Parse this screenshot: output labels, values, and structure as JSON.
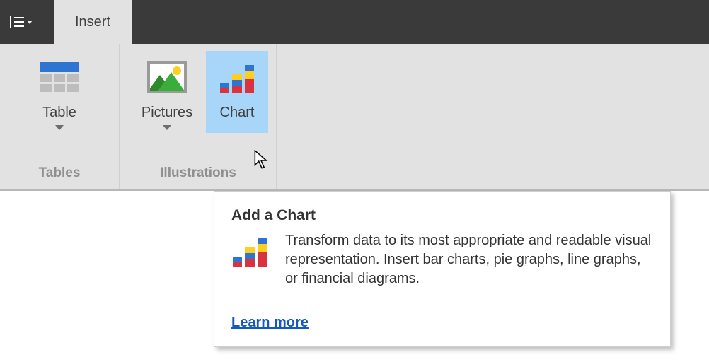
{
  "tabs": {
    "active": "Insert"
  },
  "ribbon": {
    "groups": [
      {
        "label": "Tables",
        "buttons": [
          {
            "label": "Table",
            "icon": "table-icon",
            "has_dropdown": true
          }
        ]
      },
      {
        "label": "Illustrations",
        "buttons": [
          {
            "label": "Pictures",
            "icon": "pictures-icon",
            "has_dropdown": true
          },
          {
            "label": "Chart",
            "icon": "chart-icon",
            "has_dropdown": false,
            "highlight": true
          }
        ]
      }
    ]
  },
  "tooltip": {
    "title": "Add a Chart",
    "description": "Transform data to its most appropriate and readable visual representation. Insert bar charts, pie graphs, line graphs, or financial diagrams.",
    "link_text": "Learn more"
  }
}
